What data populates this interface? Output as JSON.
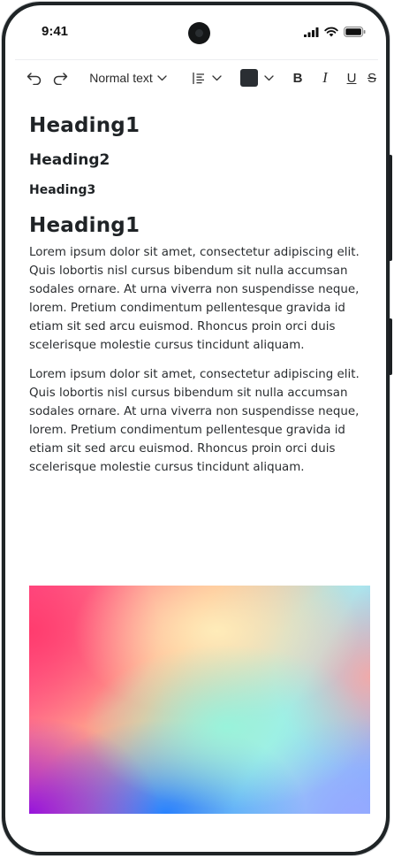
{
  "status_bar": {
    "time": "9:41",
    "icons": [
      "cellular-signal-icon",
      "wifi-icon",
      "battery-icon"
    ]
  },
  "toolbar": {
    "undo_icon": "undo-icon",
    "redo_icon": "redo-icon",
    "text_style": "Normal text",
    "align_icon": "align-left-icon",
    "text_color": "#2a2e33",
    "bold_label": "B",
    "italic_label": "I",
    "underline_label": "U",
    "strike_label": "S"
  },
  "document": {
    "heading1": "Heading1",
    "heading2": "Heading2",
    "heading3": "Heading3",
    "heading1_second": "Heading1",
    "paragraph1": "Lorem ipsum dolor sit amet, consectetur adipiscing elit. Quis lobortis nisl cursus bibendum sit nulla accumsan sodales ornare. At urna viverra non suspendisse neque, lorem. Pretium condimentum pellentesque gravida id etiam sit sed arcu euismod. Rhoncus proin orci duis scelerisque molestie cursus tincidunt aliquam.",
    "paragraph2": "Lorem ipsum dolor sit amet, consectetur adipiscing elit. Quis lobortis nisl cursus bibendum sit nulla accumsan sodales ornare. At urna viverra non suspendisse neque, lorem. Pretium condimentum pellentesque gravida id etiam sit sed arcu euismod. Rhoncus proin orci duis scelerisque molestie cursus tincidunt aliquam."
  }
}
